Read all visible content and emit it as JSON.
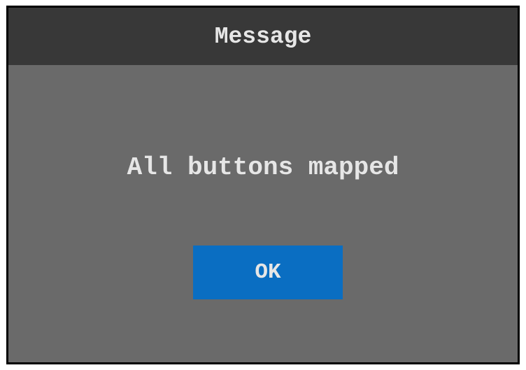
{
  "dialog": {
    "title": "Message",
    "message": "All buttons mapped",
    "ok_label": "OK"
  },
  "colors": {
    "titlebar": "#383838",
    "body": "#6a6a6a",
    "border": "#000000",
    "button": "#0a6ec2",
    "text": "#e6e6e6"
  }
}
